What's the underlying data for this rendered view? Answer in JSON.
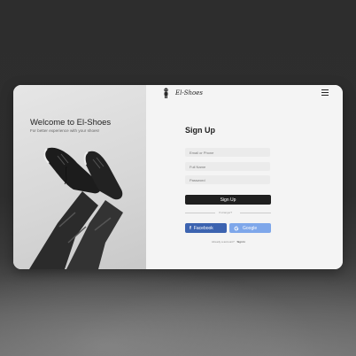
{
  "brand": {
    "name": "El-Shoes"
  },
  "hero": {
    "title": "Welcome to El-Shoes",
    "subtitle": "For better experience with your shoes!"
  },
  "form": {
    "title": "Sign Up",
    "fields": {
      "email_placeholder": "Email or Phone",
      "name_placeholder": "Full Name",
      "password_placeholder": "Password"
    },
    "submit_label": "Sign Up",
    "divider_text": "If stranger?",
    "social": {
      "facebook_label": "Facebook",
      "google_label": "Google"
    },
    "footer": {
      "prompt": "Already a account?",
      "link": "Sign In"
    }
  },
  "icons": [
    "mascot-logo-icon",
    "hamburger-menu-icon",
    "facebook-icon",
    "google-icon"
  ],
  "colors": {
    "accent_dark": "#1f1f1f",
    "facebook": "#3c63b0",
    "google": "#7ea7ea"
  }
}
